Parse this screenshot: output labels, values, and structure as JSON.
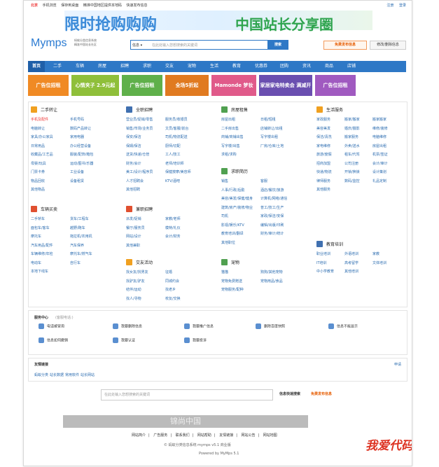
{
  "topbar": {
    "city": "北京",
    "links": [
      "手机浏览",
      "保存到桌面",
      "精准中国地区提供本地码",
      "快速发布信息"
    ],
    "right": [
      "注册",
      "登录"
    ]
  },
  "banner": {
    "t1": "限时抢购购购",
    "t2": "中国站长分享圈"
  },
  "logo": {
    "name": "Mymps",
    "sub1": "蚂蚁分类信息系统",
    "sub2": "精准中国站长社区"
  },
  "search": {
    "category": "信息 ▾",
    "placeholder": "在此处输入您想搜索的关键词",
    "button": "搜索"
  },
  "header_buttons": {
    "post": "免费发布信息",
    "edit": "修改/删除信息"
  },
  "nav": [
    "首页",
    "二手",
    "车辆",
    "房屋",
    "招聘",
    "求职",
    "交友",
    "宠物",
    "生活",
    "教育",
    "优惠券",
    "团购",
    "资讯",
    "商品",
    "店铺"
  ],
  "ads": [
    "广告位招租",
    "心情夹子 2.9元起",
    "广告位招租",
    "全场5折起",
    "Mamonde 梦妆",
    "家居家电特卖会 满减开场",
    "广告位招租"
  ],
  "categories": [
    {
      "title": "二手转让",
      "color": "#f0a020",
      "links": [
        "手机及配件",
        "手机号码",
        "电脑转让",
        "数码产品转让",
        "家具/办公家具",
        "家用电器",
        "日常用品",
        "办公经营设备",
        "收藏品/工艺品",
        "服装/配饰/箱包",
        "母婴/玩具",
        "运动/图书/乐器",
        "门票卡券",
        "工业设备",
        "物品回收",
        "设备租赁",
        "其他物品"
      ]
    },
    {
      "title": "车辆买卖",
      "color": "#e05030",
      "links": [
        "二手轿车",
        "货车/工程车",
        "面包车/客车",
        "越野/跑车",
        "摩托车",
        "拖拉机/农用机",
        "汽车用品/配件",
        "汽车保养",
        "车辆维修/年检",
        "摩托车/燃气车",
        "电动车",
        "自行车",
        "本地下线车"
      ]
    },
    {
      "title": "全职招聘",
      "color": "#4070b0",
      "links": [
        "营业员/促销/零售",
        "服务员/收银员",
        "销售/市场/业务员",
        "文员/客服/前台",
        "保安/保洁",
        "司机/物流配送",
        "保姆/保洁",
        "厨师/切配",
        "送货/快递/仓管",
        "工人/技工",
        "财务/会计",
        "老师/培训师",
        "美工/设计/程序员",
        "保健按摩/美容师",
        "人才招聘会",
        "KTV/酒吧",
        "其他招聘"
      ]
    },
    {
      "title": "兼职招聘",
      "color": "#e05030",
      "links": [
        "派发/促销",
        "家教/老师",
        "餐厅/服务员",
        "模特/礼仪",
        "网站/设计",
        "会计/财务",
        "其他兼职"
      ]
    },
    {
      "title": "交友活动",
      "color": "#f0a020",
      "links": [
        "找女友/找男友",
        "征婚",
        "找驴友/驴友",
        "同城约会",
        "结伴/运动",
        "找老乡",
        "找人/寻物",
        "校友/交换"
      ]
    },
    {
      "title": "房屋租售",
      "color": "#50a050",
      "links": [
        "房屋出租",
        "日租/短租",
        "二手房出售",
        "店铺转让/出租",
        "商铺/商铺出售",
        "写字楼出租",
        "写字楼/出售",
        "厂房/仓库/土地",
        "求租/求购"
      ]
    },
    {
      "title": "求职简历",
      "color": "#50a050",
      "links": [
        "销售",
        "客服",
        "人事/行政/后勤",
        "酒店/餐饮/旅游",
        "美容/美发/保健/健身",
        "计算机/网络/通信",
        "建筑/房产/装修/物业",
        "普工/技工/生产",
        "司机",
        "家政/保洁/安保",
        "影视/娱乐/KTV",
        "编辑/出版/印刷",
        "教育培训/翻译",
        "财务/审计/统计",
        "其他职位"
      ]
    },
    {
      "title": "宠物",
      "color": "#50a050",
      "links": [
        "猫猫",
        "狗狗/其他宠物",
        "宠物免费赠送",
        "宠物用品/食品",
        "宠物服务/配种"
      ]
    },
    {
      "title": "生活服务",
      "color": "#f0a020",
      "links": [
        "家政服务",
        "搬家/搬家",
        "搬家搬家",
        "美容美发",
        "婚庆/摄影",
        "维修/装修",
        "保洁/清洗",
        "搬家服务",
        "电脑维修",
        "家电维修",
        "外卖/送水",
        "房屋出租",
        "旅游/度假",
        "租车/代驾",
        "机票/签证",
        "招商加盟",
        "公司注册",
        "会计/审计",
        "快递/物流",
        "开锁/换锁",
        "设计策划",
        "律师服务",
        "数码/监控",
        "礼品定制",
        "其他服务"
      ]
    },
    {
      "title": "教育培训",
      "color": "#4070b0",
      "links": [
        "职业培训",
        "外语培训",
        "家教",
        "IT培训",
        "高考留学",
        "文体培训",
        "中小学教育",
        "其他培训"
      ]
    }
  ],
  "service_center": {
    "title": "服务中心",
    "subtitle": "(客服电话:)",
    "items": [
      "电话被冒用",
      "我要删除信息",
      "我要推广信息",
      "删除百度快照",
      "信息不能显示",
      "信息如何撤销",
      "我要认证",
      "我要投诉"
    ]
  },
  "friend_links": {
    "title": "友情链接",
    "apply": "申请",
    "links": [
      "蚂蚁分类",
      "站长数据",
      "常用软件",
      "站长网站"
    ]
  },
  "bottom_search": {
    "placeholder": "在此处输入您想搜索的关键词",
    "search": "信息快速搜索",
    "post": "免费发布信息"
  },
  "bottom_banner": "锦尚中国",
  "footer": {
    "links": [
      "网站简介",
      "广告服务",
      "联系我们",
      "网站帮助",
      "友情链接",
      "网站公告",
      "网站地图"
    ],
    "copyright": "© 蚂蚁分类信息系统 mymps v5.1 商业版",
    "powered": "Powered by MyMps 5.1"
  },
  "watermark": "我爱代码"
}
